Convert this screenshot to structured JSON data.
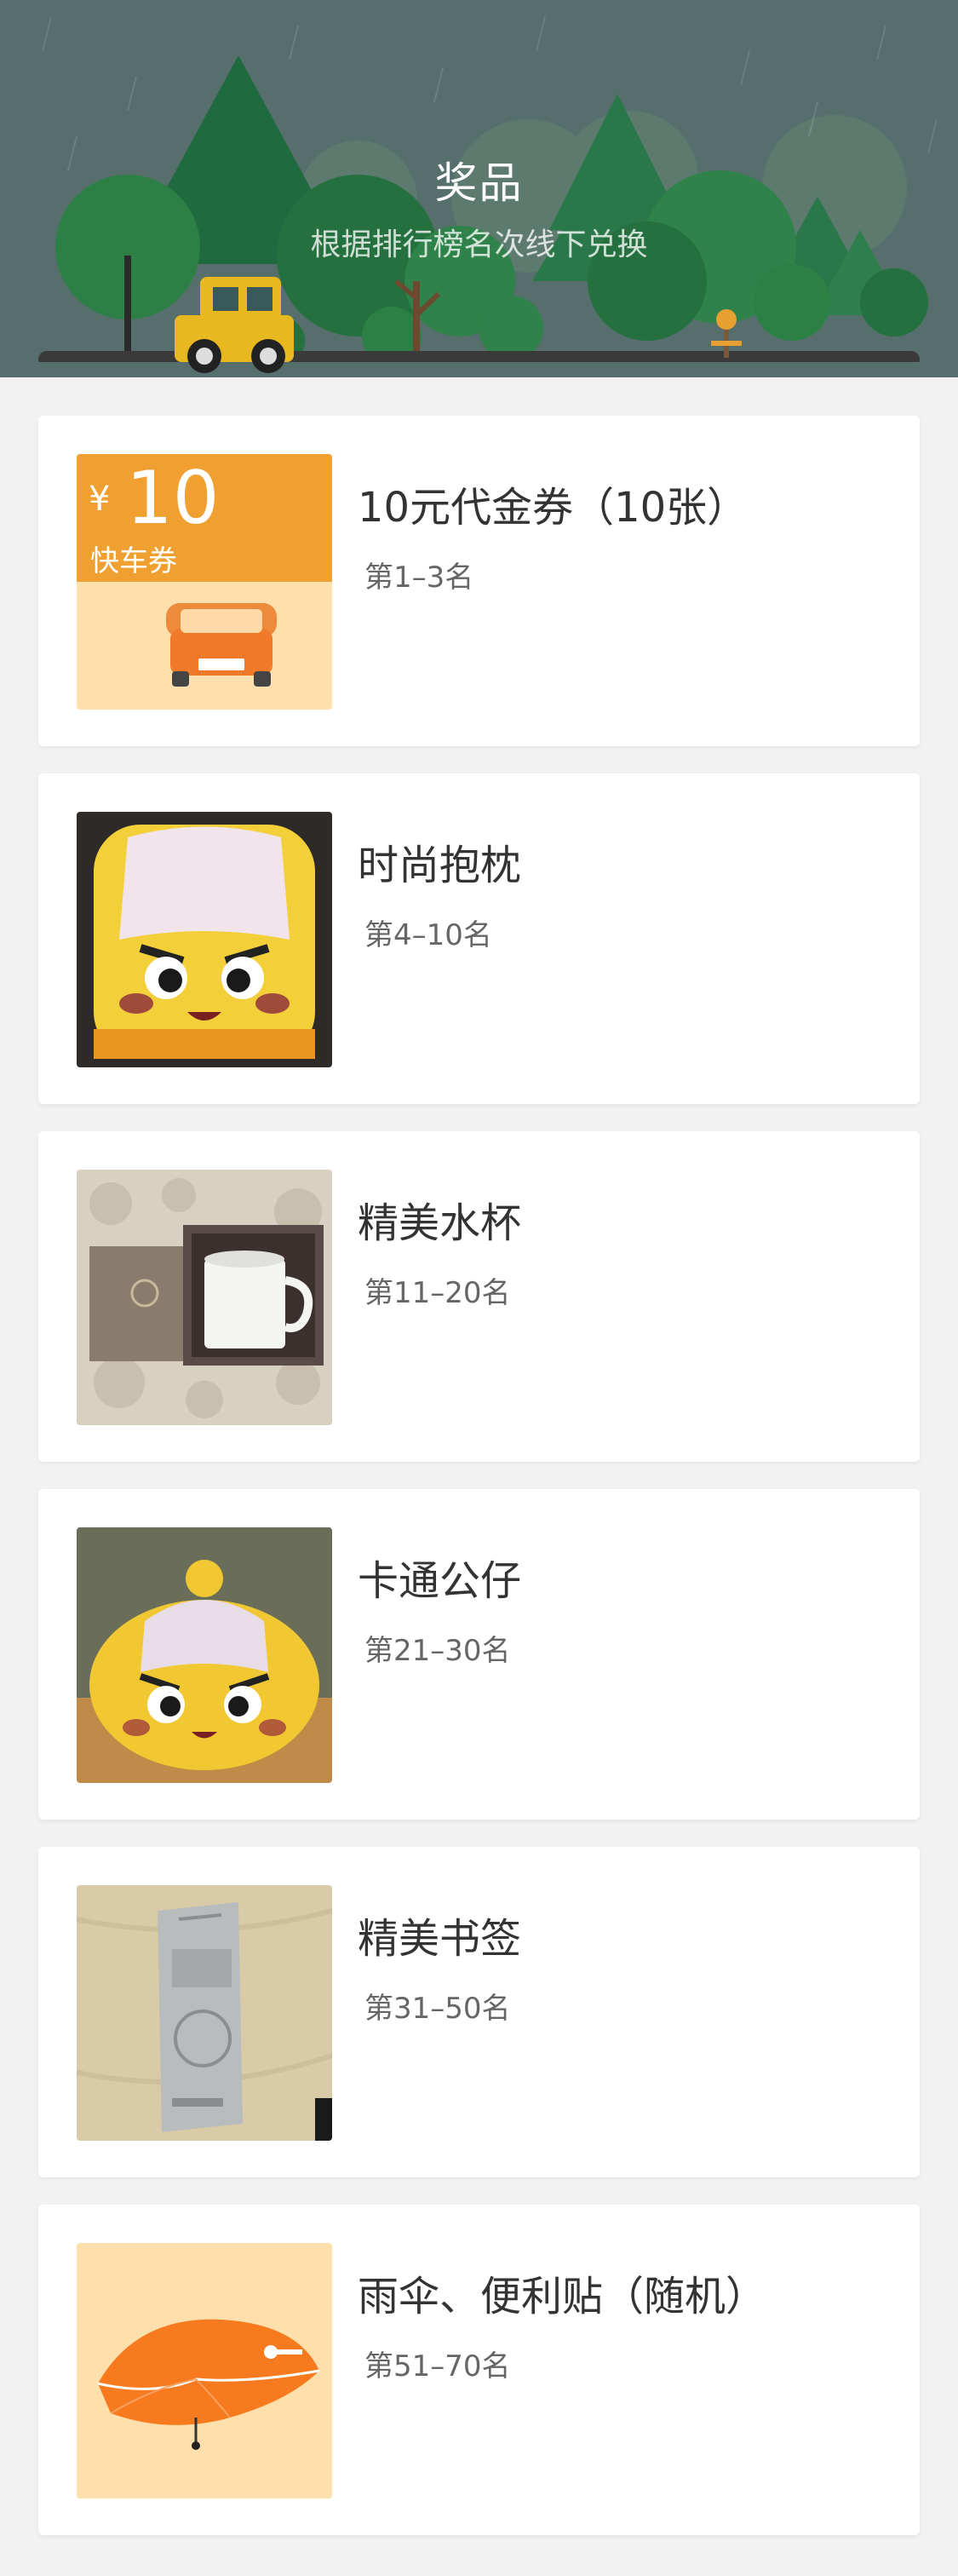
{
  "header": {
    "title": "奖品",
    "subtitle": "根据排行榜名次线下兑换"
  },
  "voucher": {
    "currency_symbol": "¥",
    "amount": "10",
    "type_label": "快车券"
  },
  "prizes": [
    {
      "name": "10元代金券（10张）",
      "rank": "第1–3名",
      "image": "voucher-image"
    },
    {
      "name": "时尚抱枕",
      "rank": "第4–10名",
      "image": "pillow-image"
    },
    {
      "name": "精美水杯",
      "rank": "第11–20名",
      "image": "mug-image"
    },
    {
      "name": "卡通公仔",
      "rank": "第21–30名",
      "image": "plush-toy-image"
    },
    {
      "name": "精美书签",
      "rank": "第31–50名",
      "image": "bookmark-image"
    },
    {
      "name": "雨伞、便利贴（随机）",
      "rank": "第51–70名",
      "image": "umbrella-image"
    }
  ],
  "colors": {
    "header_bg": "#566e6c",
    "page_bg": "#f2f2f2",
    "voucher_orange": "#f0a030",
    "voucher_cream": "#ffdfab"
  }
}
